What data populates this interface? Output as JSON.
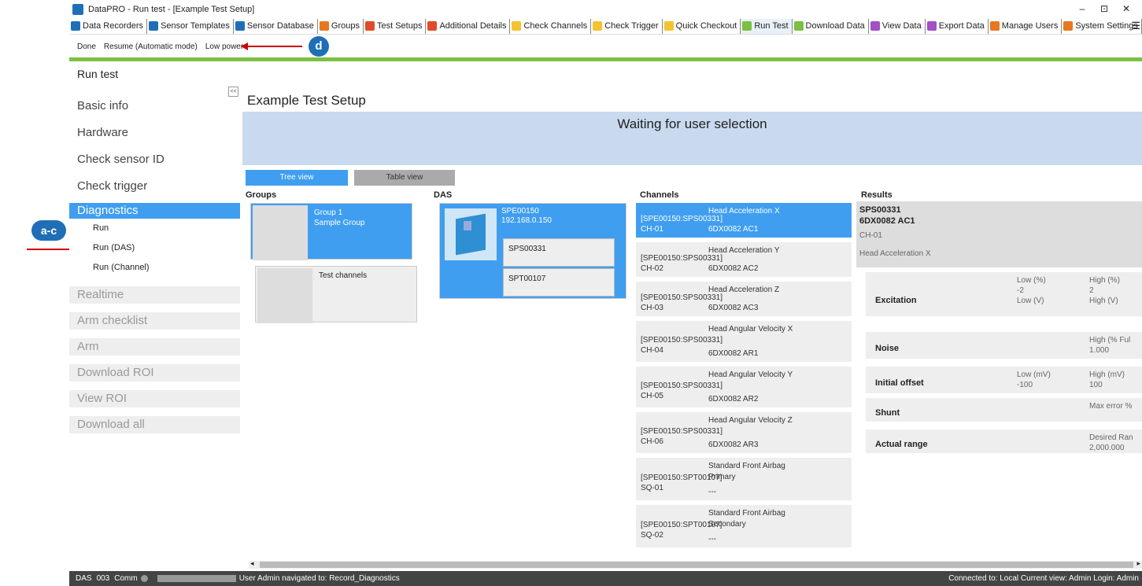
{
  "window": {
    "title": "DataPRO  - Run test - [Example Test Setup]",
    "controls": [
      "–",
      "⊡",
      "✕"
    ]
  },
  "tabs": [
    {
      "label": "Data Recorders",
      "color": "#1f6fb8"
    },
    {
      "label": "Sensor Templates",
      "color": "#1f6fb8"
    },
    {
      "label": "Sensor Database",
      "color": "#1f6fb8"
    },
    {
      "label": "Groups",
      "color": "#e87722"
    },
    {
      "label": "Test Setups",
      "color": "#e04b2b"
    },
    {
      "label": "Additional Details",
      "color": "#e04b2b"
    },
    {
      "label": "Check Channels",
      "color": "#f3c331"
    },
    {
      "label": "Check Trigger",
      "color": "#f3c331"
    },
    {
      "label": "Quick Checkout",
      "color": "#f3c331"
    },
    {
      "label": "Run Test",
      "color": "#7cc042"
    },
    {
      "label": "Download Data",
      "color": "#7cc042"
    },
    {
      "label": "View Data",
      "color": "#a34fc5"
    },
    {
      "label": "Export Data",
      "color": "#a34fc5"
    },
    {
      "label": "Manage Users",
      "color": "#e87722"
    },
    {
      "label": "System Settings",
      "color": "#e87722"
    }
  ],
  "menu_icon": "hamburger-icon",
  "commands": [
    "Done",
    "Resume (Automatic mode)",
    "Low power"
  ],
  "page_title": "Run test",
  "nav": {
    "basic": [
      "Basic info",
      "Hardware",
      "Check sensor ID",
      "Check trigger"
    ],
    "selected": "Diagnostics",
    "subitems": [
      "Run",
      "Run (DAS)",
      "Run (Channel)"
    ],
    "disabled": [
      "Realtime",
      "Arm checklist",
      "Arm",
      "Download ROI",
      "View ROI",
      "Download all"
    ],
    "collapse": "<<"
  },
  "main": {
    "setup_title": "Example Test Setup",
    "banner": "Waiting for user selection",
    "view_buttons": [
      "Tree view",
      "Table view"
    ],
    "columns": [
      "Groups",
      "DAS",
      "Channels",
      "Results"
    ]
  },
  "groups": [
    {
      "name": "Group 1",
      "desc": "Sample Group"
    },
    {
      "name": "Test channels",
      "desc": ""
    }
  ],
  "das": {
    "id": "SPE00150",
    "ip": "192.168.0.150",
    "modules": [
      "SPS00331",
      "SPT00107"
    ]
  },
  "channels": [
    {
      "id": "[SPE00150:SPS00331] CH-01",
      "name": "Head Acceleration X",
      "sensor": "6DX0082 AC1"
    },
    {
      "id": "[SPE00150:SPS00331] CH-02",
      "name": "Head Acceleration Y",
      "sensor": "6DX0082 AC2"
    },
    {
      "id": "[SPE00150:SPS00331] CH-03",
      "name": "Head Acceleration Z",
      "sensor": "6DX0082 AC3"
    },
    {
      "id": "[SPE00150:SPS00331] CH-04",
      "name": "Head Angular Velocity X",
      "sensor": "6DX0082 AR1"
    },
    {
      "id": "[SPE00150:SPS00331] CH-05",
      "name": "Head Angular Velocity Y",
      "sensor": "6DX0082 AR2"
    },
    {
      "id": "[SPE00150:SPS00331] CH-06",
      "name": "Head Angular Velocity Z",
      "sensor": "6DX0082 AR3"
    },
    {
      "id": "[SPE00150:SPT00107] SQ-01",
      "name": "Standard Front Airbag Primary",
      "sensor": "---"
    },
    {
      "id": "[SPE00150:SPT00107] SQ-02",
      "name": "Standard Front Airbag Secondary",
      "sensor": "---"
    }
  ],
  "results": {
    "module": "SPS00331",
    "sensor": "6DX0082 AC1",
    "channel": "CH-01",
    "name": "Head Acceleration X",
    "rows": [
      {
        "label": "Excitation",
        "c1": "Low (%)",
        "c1v": "-2",
        "c1b": "Low (V)",
        "c2": "High (%)",
        "c2v": "2",
        "c2b": "High (V)"
      },
      {
        "label": "Noise",
        "c1": "",
        "c1v": "",
        "c1b": "",
        "c2": "High (% Ful",
        "c2v": "1.000",
        "c2b": ""
      },
      {
        "label": "Initial offset",
        "c1": "Low (mV)",
        "c1v": "-100",
        "c1b": "",
        "c2": "High (mV)",
        "c2v": "100",
        "c2b": ""
      },
      {
        "label": "Shunt",
        "c1": "",
        "c1v": "",
        "c1b": "",
        "c2": "Max error %",
        "c2v": "",
        "c2b": ""
      },
      {
        "label": "Actual range",
        "c1": "",
        "c1v": "",
        "c1b": "",
        "c2": "Desired Ran",
        "c2v": "2,000.000",
        "c2b": ""
      }
    ]
  },
  "status": {
    "das": "DAS",
    "das_count": "003",
    "comm": "Comm",
    "message": "User Admin navigated to: Record_Diagnostics",
    "right": "Connected to:  Local   Current view: Admin  Login: Admin"
  },
  "callouts": {
    "d": "d",
    "ac": "a-c"
  }
}
